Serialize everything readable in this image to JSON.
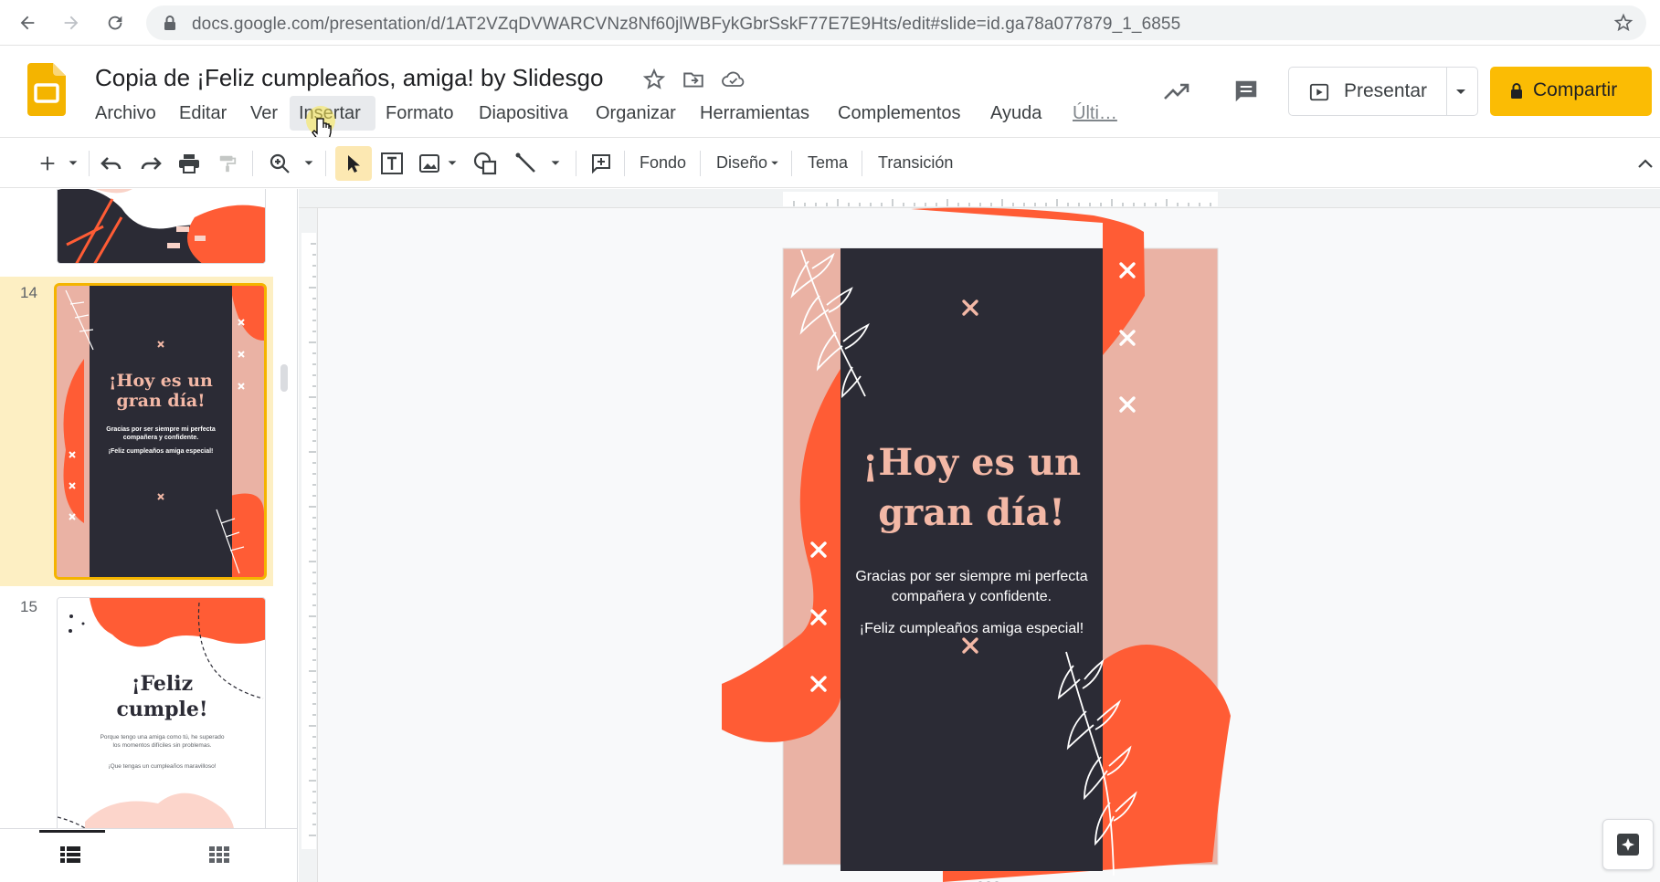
{
  "browser": {
    "url": "docs.google.com/presentation/d/1AT2VZqDVWARCVNz8Nf60jlWBFykGbrSskF77E7E9Hts/edit#slide=id.ga78a077879_1_6855"
  },
  "app": {
    "title": "Copia de ¡Feliz cumpleaños, amiga! by Slidesgo",
    "menu": [
      "Archivo",
      "Editar",
      "Ver",
      "Insertar",
      "Formato",
      "Diapositiva",
      "Organizar",
      "Herramientas",
      "Complementos",
      "Ayuda",
      "Últi…"
    ],
    "present_label": "Presentar",
    "share_label": "Compartir",
    "accent": "#fbbc04"
  },
  "toolbar": {
    "fondo": "Fondo",
    "diseno": "Diseño",
    "tema": "Tema",
    "transicion": "Transición"
  },
  "filmstrip": {
    "slide_14_num": "14",
    "slide_15_num": "15",
    "thumb14": {
      "title": "¡Hoy es un gran día!",
      "body": "Gracias por ser siempre mi perfecta compañera y confidente.",
      "footer": "¡Feliz cumpleaños amiga especial!"
    },
    "thumb15": {
      "title": "¡Feliz cumple!",
      "body": "Porque tengo una amiga como tú, he superado los momentos difíciles sin problemas.",
      "footer": "¡Que tengas un cumpleaños maravilloso!"
    }
  },
  "slide": {
    "title_line1": "¡Hoy es un",
    "title_line2": "gran día!",
    "body_line1": "Gracias por ser siempre mi perfecta",
    "body_line2": "compañera y confidente.",
    "footer": "¡Feliz cumpleaños amiga especial!",
    "colors": {
      "dark": "#2b2b35",
      "orange": "#ff5c35",
      "pink": "#eab2a4",
      "title": "#f3b8a6"
    }
  }
}
